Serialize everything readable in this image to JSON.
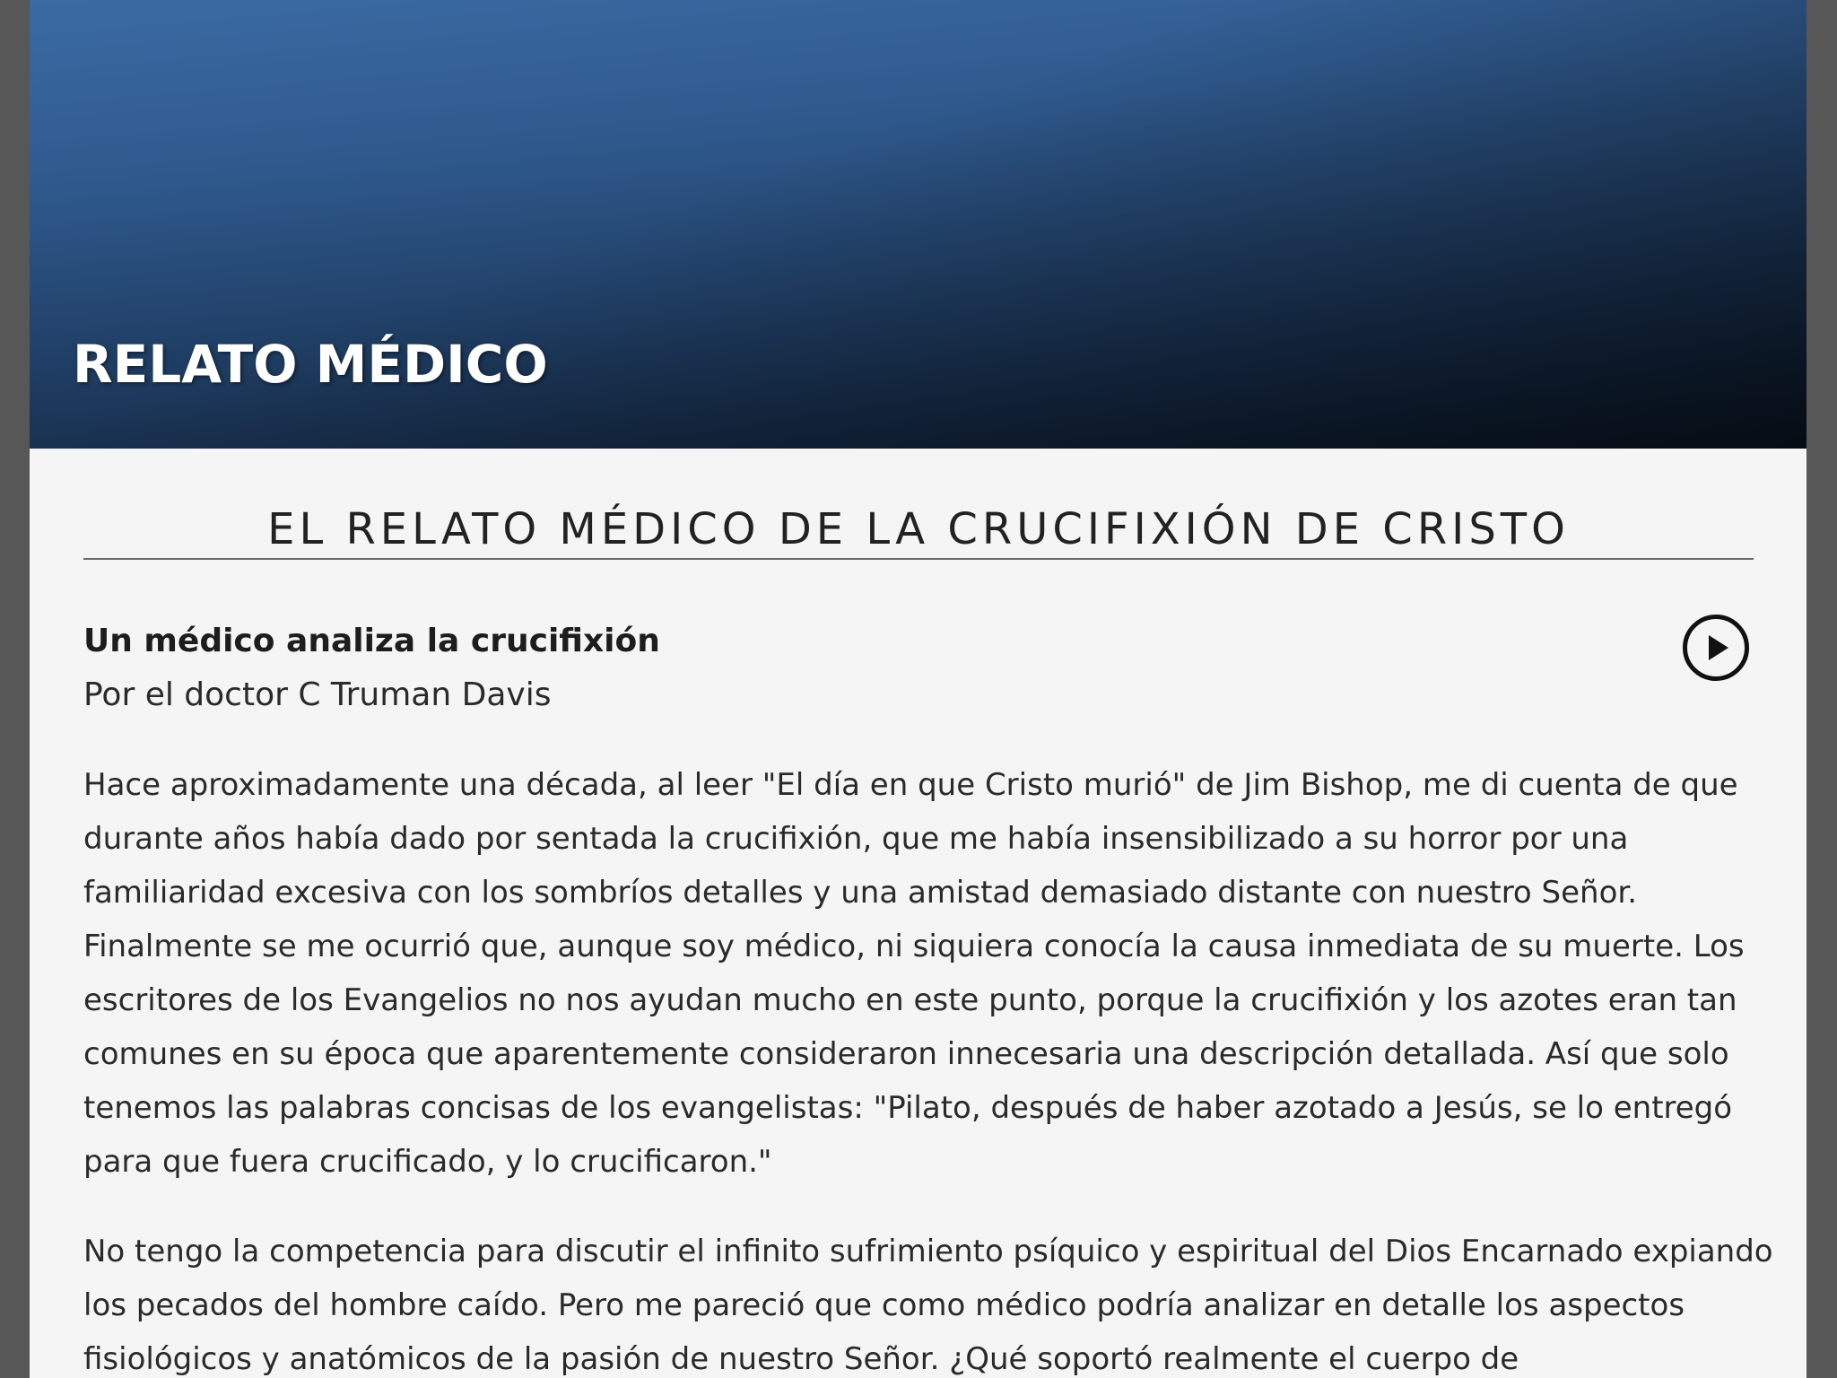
{
  "header": {
    "title": "RELATO MÉDICO"
  },
  "article": {
    "heading": "EL RELATO MÉDICO DE LA CRUCIFIXIÓN DE CRISTO",
    "subtitle": "Un médico analiza la crucifixión",
    "byline": "Por el doctor C Truman Davis",
    "play_icon": "play-circle-icon",
    "paragraphs": [
      "Hace aproximadamente una década, al leer \"El día en que Cristo murió\" de Jim Bishop, me di cuenta de que durante años había dado por sentada la crucifixión, que me había insensibilizado a su horror por una familiaridad excesiva con los sombríos detalles y una amistad demasiado distante con nuestro Señor. Finalmente se me ocurrió que, aunque soy médico, ni siquiera conocía la causa inmediata de su muerte. Los escritores de los Evangelios no nos ayudan mucho en este punto, porque la crucifixión y los azotes eran tan comunes en su época que aparentemente consideraron innecesaria una descripción detallada. Así que solo tenemos las palabras concisas de los evangelistas: \"Pilato, después de haber azotado a Jesús, se lo entregó para que fuera crucificado, y lo crucificaron.\"",
      "No tengo la competencia para discutir el infinito sufrimiento psíquico y espiritual del Dios Encarnado expiando los pecados del hombre caído. Pero me pareció que como médico podría analizar en detalle los aspectos fisiológicos y anatómicos de la pasión de nuestro Señor. ¿Qué soportó realmente el cuerpo de"
    ]
  },
  "colors": {
    "hero_top": "#3b6aa3",
    "hero_bottom": "#0c1a2c",
    "page_background": "#f5f5f5",
    "side_margin": "#575757"
  }
}
